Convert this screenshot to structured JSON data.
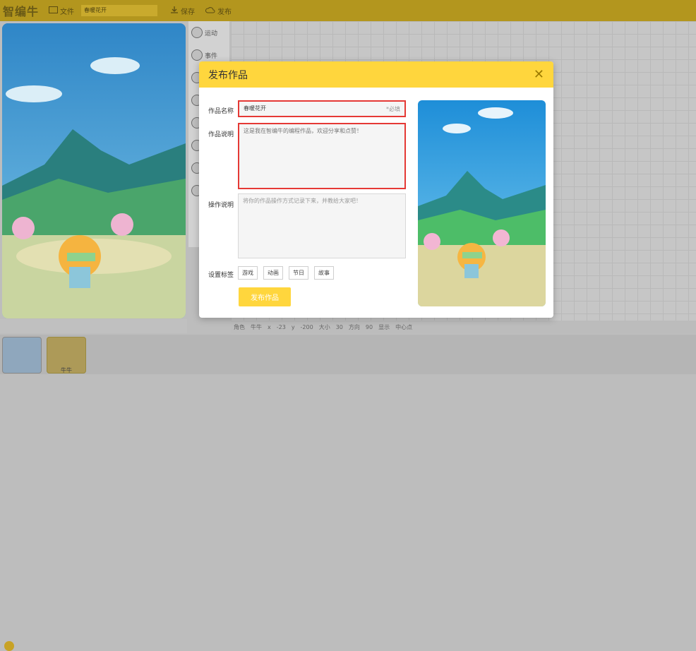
{
  "app": {
    "logo": "智编牛",
    "file_label": "文件",
    "project_name": "春暖花开",
    "save_label": "保存",
    "publish_label": "发布"
  },
  "categories": [
    {
      "label": "运动"
    },
    {
      "label": "事件"
    }
  ],
  "bottom": {
    "role_label": "角色",
    "role_value": "牛牛",
    "x_label": "x",
    "x_value": "-23",
    "y_label": "y",
    "y_value": "-200",
    "size_label": "大小",
    "size_value": "30",
    "dir_label": "方向",
    "dir_value": "90",
    "show_label": "显示",
    "center_label": "中心点"
  },
  "sprite": {
    "label": "牛牛"
  },
  "modal": {
    "title": "发布作品",
    "name_label": "作品名称",
    "name_value": "春暖花开",
    "name_required": "*必填",
    "desc_label": "作品说明",
    "desc_value": "这是我在智编牛的编程作品，欢迎分享和点赞！",
    "ops_label": "操作说明",
    "ops_placeholder": "将你的作品操作方式记录下来，并教给大家吧！",
    "tags_label": "设置标签",
    "tags": [
      "游戏",
      "动画",
      "节日",
      "故事"
    ],
    "publish_button": "发布作品"
  },
  "colors": {
    "accent": "#ffd63d",
    "error_border": "#e53935",
    "topbar": "#b3961e"
  }
}
